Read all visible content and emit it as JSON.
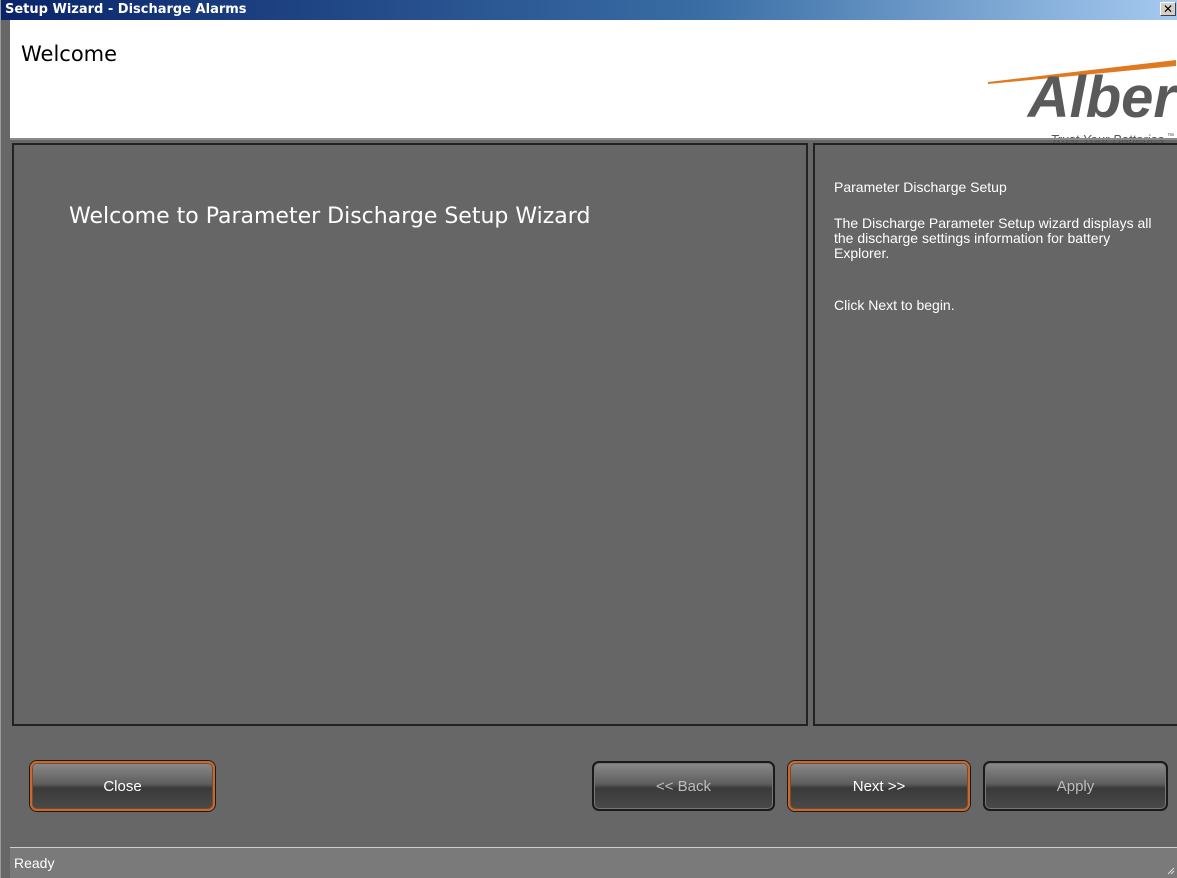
{
  "window": {
    "title": "Setup Wizard - Discharge Alarms",
    "close_glyph": "✕"
  },
  "header": {
    "title": "Welcome",
    "logo_text": "Alber",
    "logo_tagline": "Trust Your Batteries",
    "logo_tm": "™"
  },
  "main": {
    "welcome_text": "Welcome to Parameter Discharge Setup Wizard"
  },
  "info": {
    "heading": "Parameter Discharge Setup",
    "description": "The Discharge Parameter Setup wizard displays all the discharge settings information for battery Explorer.",
    "instruction": "Click Next to begin."
  },
  "buttons": {
    "close": "Close",
    "back": "<< Back",
    "next": "Next >>",
    "apply": "Apply"
  },
  "status": {
    "text": "Ready"
  },
  "colors": {
    "accent_border": "#c8682c",
    "panel": "#666666",
    "logo_gray": "#5a5a5a",
    "logo_orange": "#e07a20"
  }
}
